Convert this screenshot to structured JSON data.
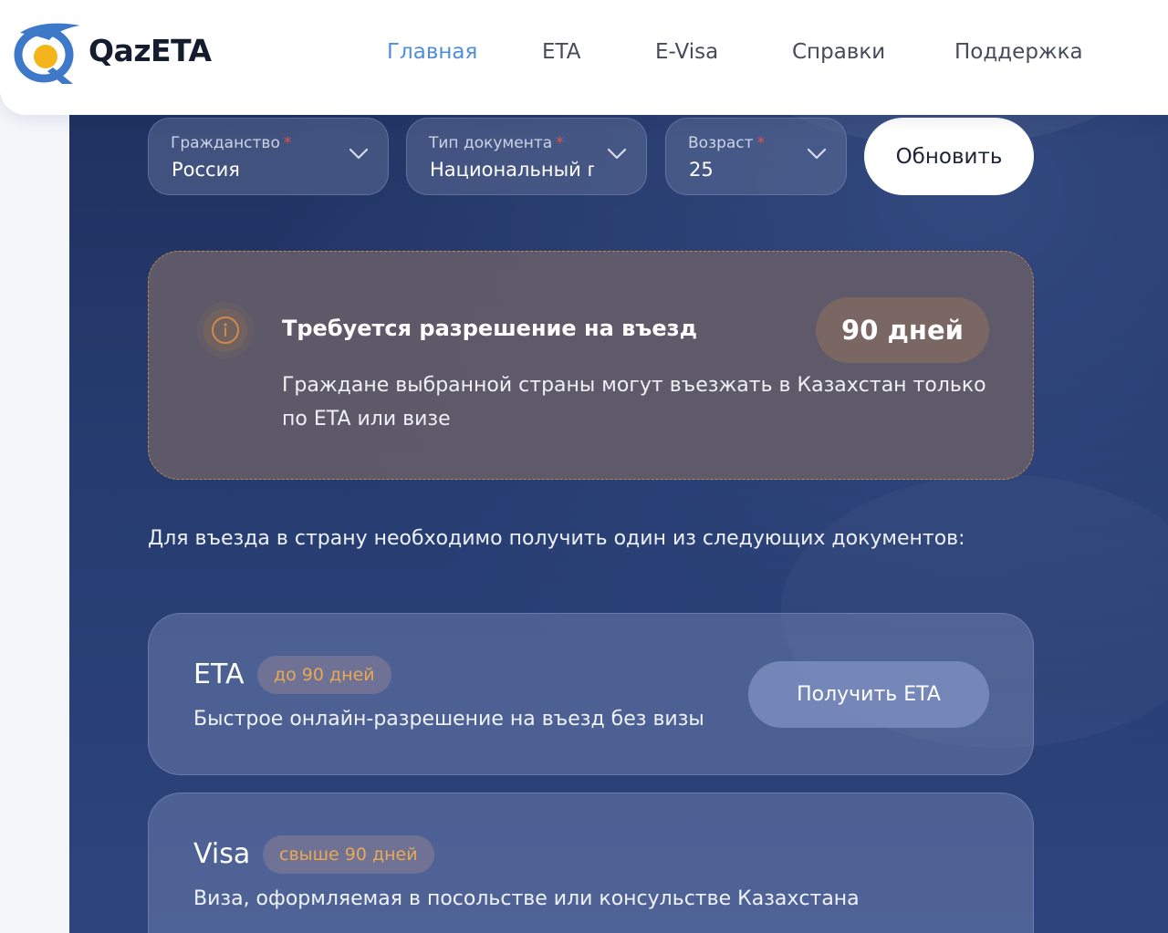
{
  "header": {
    "logo_text": "QazETA",
    "nav": [
      "Главная",
      "ETA",
      "E-Visa",
      "Справки",
      "Поддержка"
    ],
    "active_nav": "Главная"
  },
  "filters": {
    "citizenship": {
      "label": "Гражданство",
      "value": "Россия"
    },
    "document_type": {
      "label": "Тип документа",
      "value": "Национальный п"
    },
    "age": {
      "label": "Возраст",
      "value": "25"
    },
    "required_mark": "*",
    "refresh_label": "Обновить"
  },
  "alert": {
    "title": "Требуется разрешение на въезд",
    "badge": "90 дней",
    "text": "Граждане выбранной страны могут въезжать в Казахстан только по ETA или визе"
  },
  "intro": "Для въезда в страну необходимо получить один из следующих документов:",
  "options": {
    "eta": {
      "title": "ETA",
      "badge": "до 90 дней",
      "description": "Быстрое онлайн-разрешение на въезд без визы",
      "button": "Получить ETA"
    },
    "visa": {
      "title": "Visa",
      "badge": "свыше 90 дней",
      "description": "Виза, оформляемая в посольстве или консульстве Казахстана"
    }
  },
  "colors": {
    "accent_nav": "#4f8fd9",
    "panel_bg": "#243765",
    "warning_border": "#c4874a",
    "badge_text": "#e6a955",
    "required": "#e0544f"
  },
  "icons": {
    "logo": "qazeta-logo-icon",
    "select_chevron": "chevron-down-icon",
    "info": "info-icon"
  }
}
